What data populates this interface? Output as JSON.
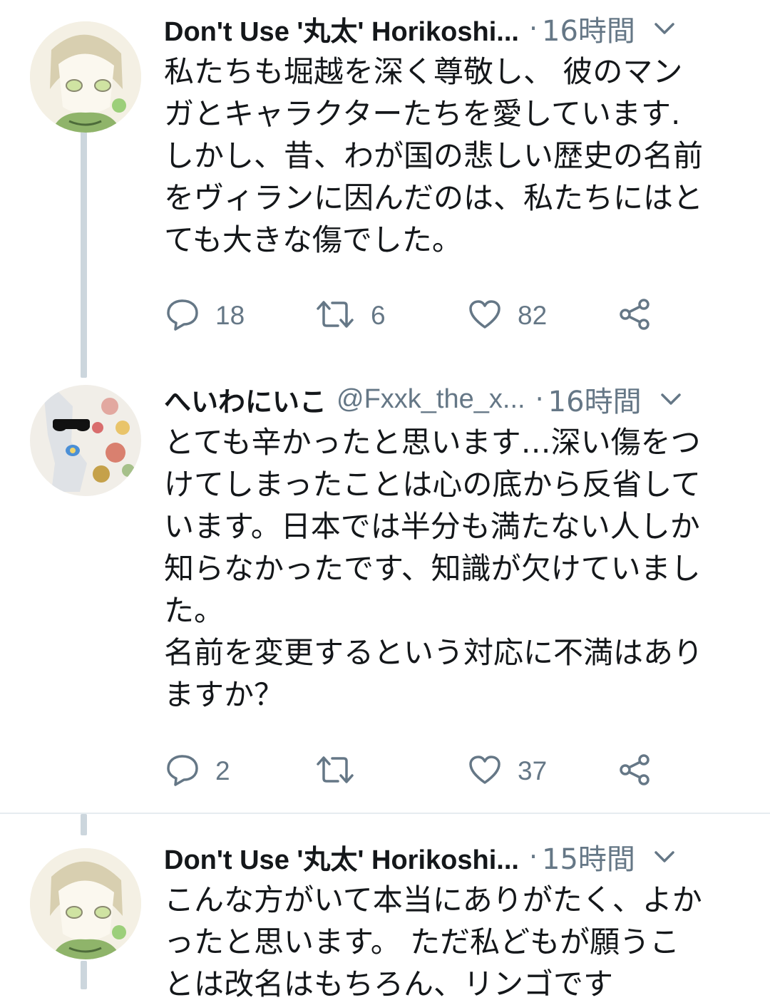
{
  "tweets": [
    {
      "name": "Don't Use '丸太' Horikoshi...",
      "handle": "",
      "time": "16時間",
      "text": "私たちも堀越を深く尊敬し、 彼のマン\nガとキャラクターたちを愛しています.\nしかし、昔、わが国の悲しい歴史の名前\nをヴィランに因んだのは、私たちにはと\nても大きな傷でした。",
      "reply_count": "18",
      "retweet_count": "6",
      "like_count": "82"
    },
    {
      "name": "へいわにいこ",
      "handle": "@Fxxk_the_x...",
      "time": "16時間",
      "text": "とても辛かったと思います…深い傷をつ\nけてしまったことは心の底から反省して\nいます。日本では半分も満たない人しか\n知らなかったです、知識が欠けていまし\nた。\n名前を変更するという対応に不満はあり\nますか？",
      "reply_count": "2",
      "retweet_count": "",
      "like_count": "37"
    },
    {
      "name": "Don't Use '丸太' Horikoshi...",
      "handle": "",
      "time": "15時間",
      "text": "こんな方がいて本当にありがたく、よか\nったと思います。 ただ私どもが願うこ\nとは改名はもちろん、リンゴです"
    }
  ],
  "dot": "·",
  "colors": {
    "text": "#14171a",
    "secondary": "#657786",
    "thread_line": "#ccd6dd",
    "divider": "#e6ecf0"
  },
  "icons": [
    "reply-icon",
    "retweet-icon",
    "like-icon",
    "share-icon",
    "chevron-down-icon"
  ]
}
